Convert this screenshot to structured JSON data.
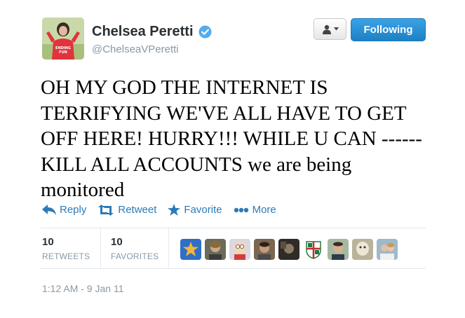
{
  "user": {
    "name": "Chelsea Peretti",
    "handle": "@ChelseaVPeretti",
    "verified": true,
    "avatar_shirt_text": "ENDING FUN"
  },
  "header": {
    "follow_label": "Following",
    "accent": "#2b7bb9"
  },
  "tweet": {
    "text": "OH MY GOD THE INTERNET IS TERRIFYING WE'VE ALL HAVE TO GET OFF HERE! HURRY!!! WHILE U CAN ------ KILL ALL ACCOUNTS we are being monitored",
    "timestamp": "1:12 AM - 9 Jan 11"
  },
  "actions": [
    {
      "label": "Reply",
      "icon": "reply-icon"
    },
    {
      "label": "Retweet",
      "icon": "retweet-icon"
    },
    {
      "label": "Favorite",
      "icon": "star-icon"
    },
    {
      "label": "More",
      "icon": "more-dots-icon"
    }
  ],
  "stats": {
    "retweets_count": "10",
    "retweets_label": "RETWEETS",
    "favorites_count": "10",
    "favorites_label": "FAVORITES"
  },
  "favoriters": [
    {
      "name": "favoriter-1-star"
    },
    {
      "name": "favoriter-2"
    },
    {
      "name": "favoriter-3-cartoon"
    },
    {
      "name": "favoriter-4"
    },
    {
      "name": "favoriter-5"
    },
    {
      "name": "favoriter-6-crest"
    },
    {
      "name": "favoriter-7"
    },
    {
      "name": "favoriter-8"
    },
    {
      "name": "favoriter-9"
    }
  ]
}
